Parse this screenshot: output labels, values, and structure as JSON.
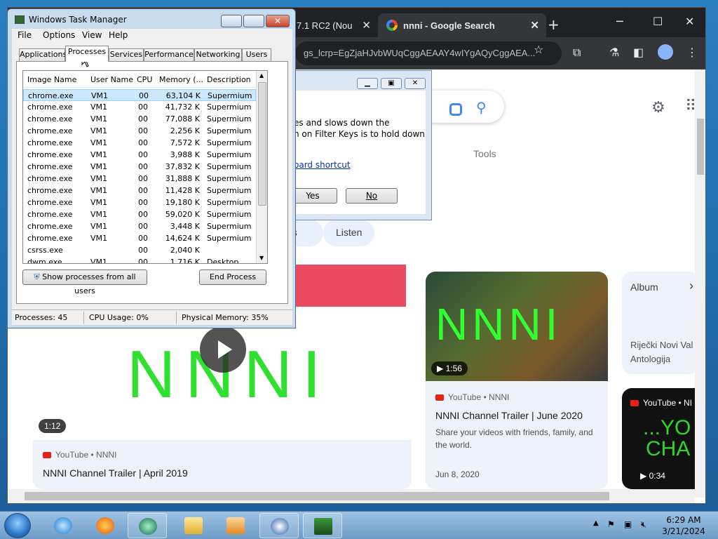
{
  "chrome": {
    "inactive_tab": "7.1 RC2 (Nou",
    "active_tab": "nnni - Google Search",
    "close_glyph": "✕",
    "new_tab_glyph": "+",
    "address": "gs_lcrp=EgZjaHJvbWUqCggAEAAY4wIYgAQyCggAEA...",
    "star_glyph": "☆",
    "tools_label": "Tools",
    "chip_label_1": "os",
    "chip_label_2": "Listen",
    "video1": {
      "duration": "1:12",
      "source": "YouTube • NNNI",
      "title": "NNNI Channel Trailer | April 2019",
      "thumb_text": "NNNI"
    },
    "video2": {
      "duration": "1:56",
      "source": "YouTube • NNNI",
      "title": "NNNI Channel Trailer | June 2020",
      "description": "Share your videos with friends, family, and the world.",
      "date": "Jun 8, 2020",
      "thumb_text": "NNNI"
    },
    "album": {
      "label": "Album",
      "line1": "Riječki Novi Val",
      "line2": "Antologija",
      "chevron": "›"
    },
    "video3": {
      "source": "YouTube • NI",
      "thumb_text_1": "...YO",
      "thumb_text_2": "CHA",
      "duration": "0:34"
    }
  },
  "dialog": {
    "text_line1": "es and slows down the",
    "text_line2": "h on Filter Keys is to hold down",
    "link_text": "oard shortcut",
    "yes_label": "Yes",
    "no_label": "No"
  },
  "taskmanager": {
    "title": "Windows Task Manager",
    "menu": [
      "File",
      "Options",
      "View",
      "Help"
    ],
    "tabs": [
      "Applications",
      "Processes",
      "Services",
      "Performance",
      "Networking",
      "Users"
    ],
    "columns": [
      "Image Name",
      "User Name",
      "CPU",
      "Memory (...",
      "Description"
    ],
    "rows": [
      [
        "chrome.exe",
        "VM1",
        "00",
        "63,104 K",
        "Supermium"
      ],
      [
        "chrome.exe",
        "VM1",
        "00",
        "41,732 K",
        "Supermium"
      ],
      [
        "chrome.exe",
        "VM1",
        "00",
        "77,088 K",
        "Supermium"
      ],
      [
        "chrome.exe",
        "VM1",
        "00",
        "2,256 K",
        "Supermium"
      ],
      [
        "chrome.exe",
        "VM1",
        "00",
        "7,572 K",
        "Supermium"
      ],
      [
        "chrome.exe",
        "VM1",
        "00",
        "3,988 K",
        "Supermium"
      ],
      [
        "chrome.exe",
        "VM1",
        "00",
        "37,832 K",
        "Supermium"
      ],
      [
        "chrome.exe",
        "VM1",
        "00",
        "31,888 K",
        "Supermium"
      ],
      [
        "chrome.exe",
        "VM1",
        "00",
        "11,428 K",
        "Supermium"
      ],
      [
        "chrome.exe",
        "VM1",
        "00",
        "19,180 K",
        "Supermium"
      ],
      [
        "chrome.exe",
        "VM1",
        "00",
        "59,020 K",
        "Supermium"
      ],
      [
        "chrome.exe",
        "VM1",
        "00",
        "3,448 K",
        "Supermium"
      ],
      [
        "chrome.exe",
        "VM1",
        "00",
        "14,624 K",
        "Supermium"
      ],
      [
        "csrss.exe",
        "",
        "00",
        "2,040 K",
        ""
      ],
      [
        "dwm.exe",
        "VM1",
        "00",
        "1,716 K",
        "Desktop ..."
      ]
    ],
    "show_all_label": "Show processes from all users",
    "end_process_label": "End Process",
    "status_processes": "Processes: 45",
    "status_cpu": "CPU Usage: 0%",
    "status_memory": "Physical Memory: 35%"
  },
  "taskbar": {
    "time": "6:29 AM",
    "date": "3/21/2024"
  }
}
